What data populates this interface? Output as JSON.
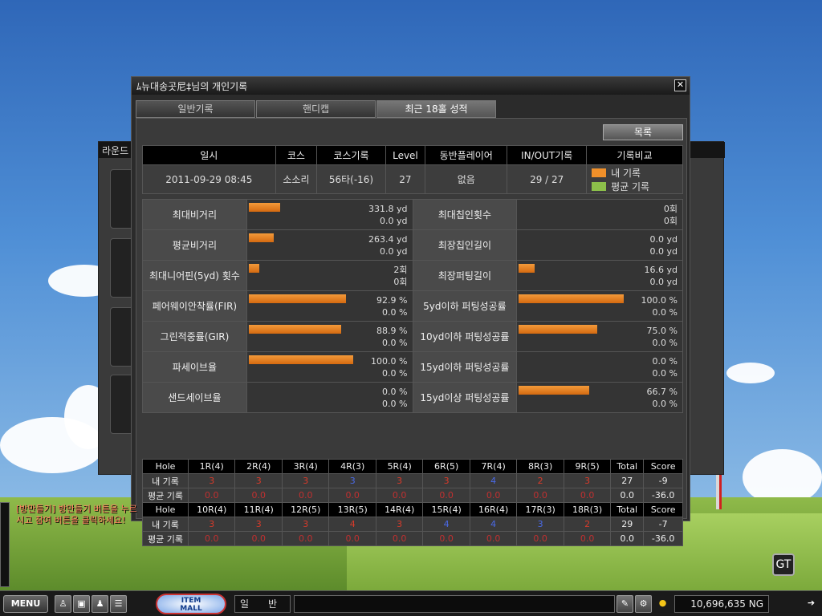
{
  "window": {
    "title": "ﾑ뉴대송곳尼‡님의 개인기록",
    "close": "✕"
  },
  "back_panel": {
    "title": "라운드"
  },
  "tabs": [
    {
      "label": "일반기록"
    },
    {
      "label": "핸디캡"
    },
    {
      "label": "최근 18홀 성적"
    }
  ],
  "list_button": "목록",
  "summary": {
    "headers": [
      "일시",
      "코스",
      "코스기록",
      "Level",
      "동반플레이어",
      "IN/OUT기록",
      "기록비교"
    ],
    "values": [
      "2011-09-29 08:45",
      "소소리",
      "56타(-16)",
      "27",
      "없음",
      "29 / 27"
    ],
    "legend": [
      {
        "label": "내 기록",
        "color": "#f0902a"
      },
      {
        "label": "평균 기록",
        "color": "#8cc04a"
      }
    ]
  },
  "stats": [
    {
      "l": "최대비거리",
      "v1": "331.8 yd",
      "v2": "0.0 yd",
      "p": 0.2,
      "r": "최대칩인횟수",
      "rv1": "0회",
      "rv2": "0회",
      "rp": 0
    },
    {
      "l": "평균비거리",
      "v1": "263.4 yd",
      "v2": "0.0 yd",
      "p": 0.16,
      "r": "최장칩인길이",
      "rv1": "0.0 yd",
      "rv2": "0.0 yd",
      "rp": 0
    },
    {
      "l": "최대니어핀(5yd) 횟수",
      "v1": "2회",
      "v2": "0회",
      "p": 0.07,
      "r": "최장퍼팅길이",
      "rv1": "16.6 yd",
      "rv2": "0.0 yd",
      "rp": 0.1
    },
    {
      "l": "페어웨이안착률(FIR)",
      "v1": "92.9 %",
      "v2": "0.0 %",
      "p": 0.62,
      "r": "5yd이하 퍼팅성공률",
      "rv1": "100.0 %",
      "rv2": "0.0 %",
      "rp": 0.67
    },
    {
      "l": "그린적중률(GIR)",
      "v1": "88.9 %",
      "v2": "0.0 %",
      "p": 0.59,
      "r": "10yd이하 퍼팅성공률",
      "rv1": "75.0 %",
      "rv2": "0.0 %",
      "rp": 0.5
    },
    {
      "l": "파세이브율",
      "v1": "100.0 %",
      "v2": "0.0 %",
      "p": 0.67,
      "r": "15yd이하 퍼팅성공률",
      "rv1": "0.0 %",
      "rv2": "0.0 %",
      "rp": 0
    },
    {
      "l": "샌드세이브율",
      "v1": "0.0 %",
      "v2": "0.0 %",
      "p": 0,
      "r": "15yd이상 퍼팅성공률",
      "rv1": "66.7 %",
      "rv2": "0.0 %",
      "rp": 0.45
    }
  ],
  "scorecard": {
    "front": {
      "holes": [
        "Hole",
        "1R(4)",
        "2R(4)",
        "3R(4)",
        "4R(3)",
        "5R(4)",
        "6R(5)",
        "7R(4)",
        "8R(3)",
        "9R(5)",
        "Total",
        "Score"
      ],
      "my": [
        "내 기록",
        "3",
        "3",
        "3",
        "3",
        "3",
        "3",
        "4",
        "2",
        "3",
        "27",
        "-9"
      ],
      "avg": [
        "평균 기록",
        "0.0",
        "0.0",
        "0.0",
        "0.0",
        "0.0",
        "0.0",
        "0.0",
        "0.0",
        "0.0",
        "0.0",
        "-36.0"
      ],
      "my_blue": [
        4,
        7
      ]
    },
    "back": {
      "holes": [
        "Hole",
        "10R(4)",
        "11R(4)",
        "12R(5)",
        "13R(5)",
        "14R(4)",
        "15R(4)",
        "16R(4)",
        "17R(3)",
        "18R(3)",
        "Total",
        "Score"
      ],
      "my": [
        "내 기록",
        "3",
        "3",
        "3",
        "4",
        "3",
        "4",
        "4",
        "3",
        "2",
        "29",
        "-7"
      ],
      "avg": [
        "평균 기록",
        "0.0",
        "0.0",
        "0.0",
        "0.0",
        "0.0",
        "0.0",
        "0.0",
        "0.0",
        "0.0",
        "0.0",
        "-36.0"
      ],
      "my_blue": [
        6,
        7,
        8
      ]
    }
  },
  "taskbar": {
    "menu": "MENU",
    "itemmall_1": "ITEM",
    "itemmall_2": "MALL",
    "chat_mode": "일　　반",
    "money": "10,696,635 NG"
  },
  "chat": {
    "text": "[방만들기] 방만들기 버튼을 누르시고 참여 버튼을 클릭하세요!"
  },
  "clock": "GT"
}
